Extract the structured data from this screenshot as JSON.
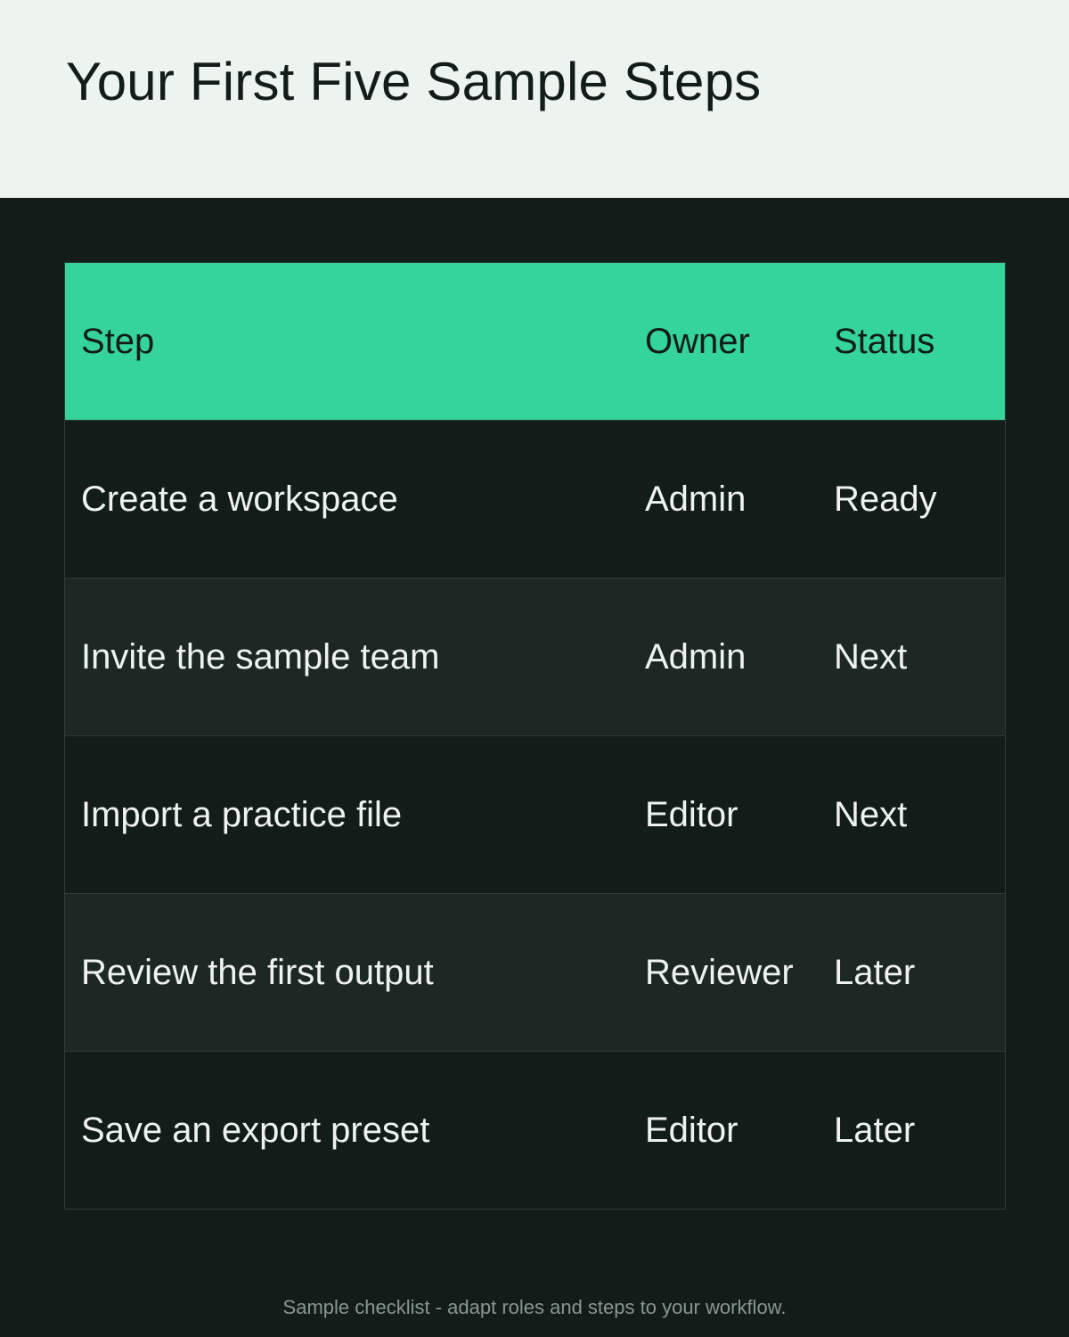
{
  "page": {
    "title": "Your First Five Sample Steps",
    "footer_note": "Sample checklist - adapt roles and steps to your workflow."
  },
  "colors": {
    "header_bg": "#edf3ef",
    "page_bg": "#121c19",
    "table_head_bg": "#35d49b",
    "row_alt_bg": "#1d2724",
    "text_light": "#eef3f0",
    "text_dark": "#121c19"
  },
  "table": {
    "columns": [
      "Step",
      "Owner",
      "Status"
    ],
    "rows": [
      {
        "step": "Create a workspace",
        "owner": "Admin",
        "status": "Ready"
      },
      {
        "step": "Invite the sample team",
        "owner": "Admin",
        "status": "Next"
      },
      {
        "step": "Import a practice file",
        "owner": "Editor",
        "status": "Next"
      },
      {
        "step": "Review the first output",
        "owner": "Reviewer",
        "status": "Later"
      },
      {
        "step": "Save an export preset",
        "owner": "Editor",
        "status": "Later"
      }
    ]
  }
}
